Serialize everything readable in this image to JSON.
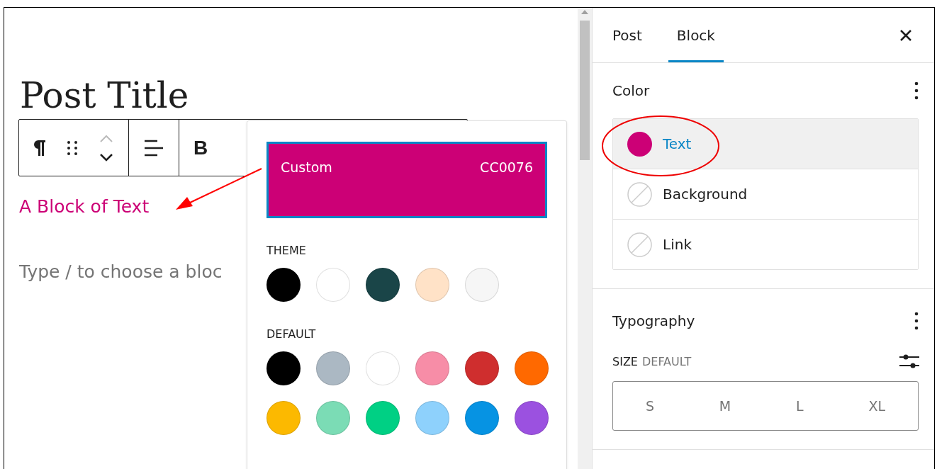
{
  "editor": {
    "title": "Post Title",
    "block_text": "A Block of Text",
    "placeholder": "Type / to choose a bloc",
    "toolbar": {
      "bold_label": "B"
    }
  },
  "color_popover": {
    "custom": {
      "label": "Custom",
      "value": "CC0076",
      "color": "#cc0076"
    },
    "groups": [
      {
        "label": "THEME",
        "swatches": [
          {
            "color": "#000000"
          },
          {
            "color": "#ffffff"
          },
          {
            "color": "#1a4548"
          },
          {
            "color": "#ffe2c7"
          },
          {
            "color": "#f6f6f6"
          }
        ]
      },
      {
        "label": "DEFAULT",
        "swatches": [
          {
            "color": "#000000"
          },
          {
            "color": "#abb8c3"
          },
          {
            "color": "#ffffff"
          },
          {
            "color": "#f78da7"
          },
          {
            "color": "#cf2e2e"
          },
          {
            "color": "#ff6900"
          },
          {
            "color": "#fcb900"
          },
          {
            "color": "#7bdcb5"
          },
          {
            "color": "#00d084"
          },
          {
            "color": "#8ed1fc"
          },
          {
            "color": "#0693e3"
          },
          {
            "color": "#9b51e0"
          }
        ]
      }
    ]
  },
  "sidebar": {
    "tabs": [
      {
        "label": "Post",
        "selected": false
      },
      {
        "label": "Block",
        "selected": true
      }
    ],
    "color_panel": {
      "title": "Color",
      "items": [
        {
          "label": "Text",
          "color": "#cc0076",
          "selected": true
        },
        {
          "label": "Background",
          "selected": false
        },
        {
          "label": "Link",
          "selected": false
        }
      ]
    },
    "typography_panel": {
      "title": "Typography",
      "size_label": "SIZE",
      "size_value": "DEFAULT",
      "sizes": [
        {
          "label": "S",
          "selected": false
        },
        {
          "label": "M",
          "selected": false
        },
        {
          "label": "L",
          "selected": false
        },
        {
          "label": "XL",
          "selected": false
        }
      ]
    }
  }
}
